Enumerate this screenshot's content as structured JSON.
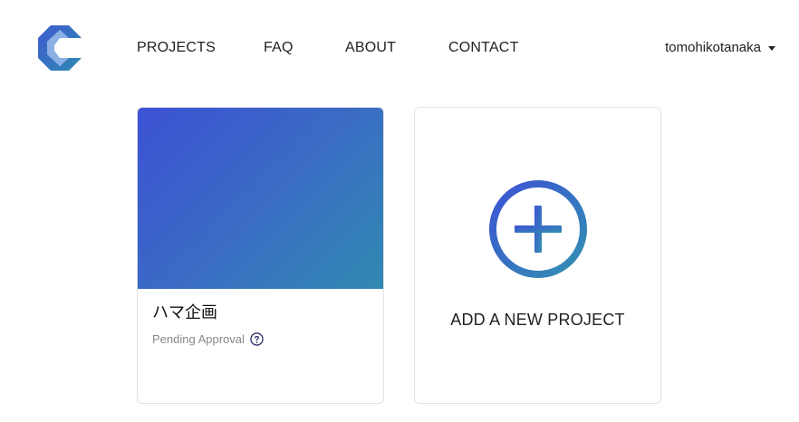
{
  "nav": {
    "items": [
      {
        "label": "PROJECTS"
      },
      {
        "label": "FAQ"
      },
      {
        "label": "ABOUT"
      },
      {
        "label": "CONTACT"
      }
    ],
    "user": "tomohikotanaka"
  },
  "projects": [
    {
      "name": "ハマ企画",
      "status": "Pending Approval"
    }
  ],
  "add_card": {
    "label": "ADD A NEW PROJECT"
  },
  "colors": {
    "brand_blue": "#3d52d5",
    "brand_teal": "#3189b2"
  },
  "icons": {
    "logo": "brand-logo-icon",
    "caret": "caret-down-icon",
    "help": "question-circle-icon",
    "add": "plus-circle-icon"
  }
}
